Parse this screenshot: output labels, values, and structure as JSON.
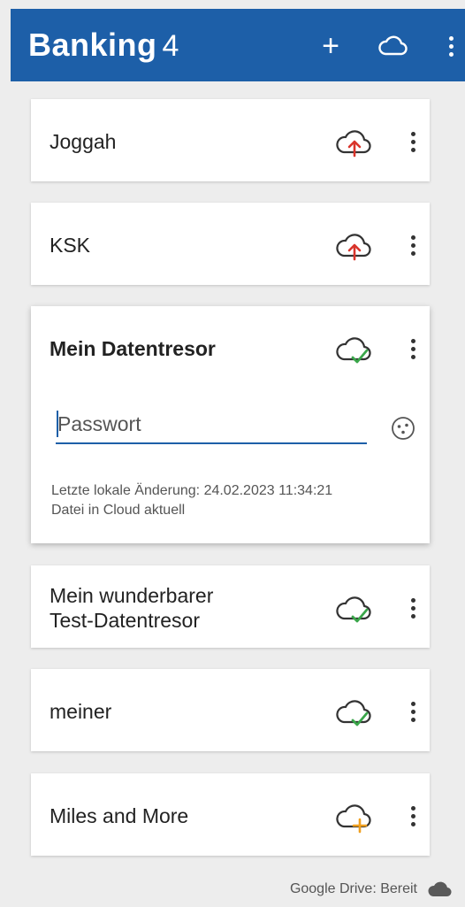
{
  "app": {
    "title": "Banking",
    "title_suffix": "4",
    "brand_color": "#1d5fa8",
    "actions": {
      "add_label": "+",
      "cloud_icon": "cloud-outline-icon",
      "more_icon": "more-vert-icon"
    }
  },
  "accounts": [
    {
      "name": "Joggah",
      "status_icon": "cloud-upload-icon",
      "status_color": "#d9342b"
    },
    {
      "name": "KSK",
      "status_icon": "cloud-upload-icon",
      "status_color": "#d9342b"
    },
    {
      "name": "Mein Datentresor",
      "status_icon": "cloud-check-icon",
      "status_color": "#3aa64a",
      "expanded": true,
      "password_placeholder": "Passwort",
      "info_line1": "Letzte lokale Änderung: 24.02.2023 11:34:21",
      "info_line2": "Datei in Cloud aktuell"
    },
    {
      "name_line1": "Mein wunderbarer",
      "name_line2": "Test-Datentresor",
      "status_icon": "cloud-check-icon",
      "status_color": "#3aa64a"
    },
    {
      "name": "meiner",
      "status_icon": "cloud-check-icon",
      "status_color": "#3aa64a"
    },
    {
      "name": "Miles and More",
      "status_icon": "cloud-add-icon",
      "status_color": "#f0a020"
    }
  ],
  "footer": {
    "status": "Google Drive: Bereit",
    "icon": "cloud-filled-icon"
  }
}
